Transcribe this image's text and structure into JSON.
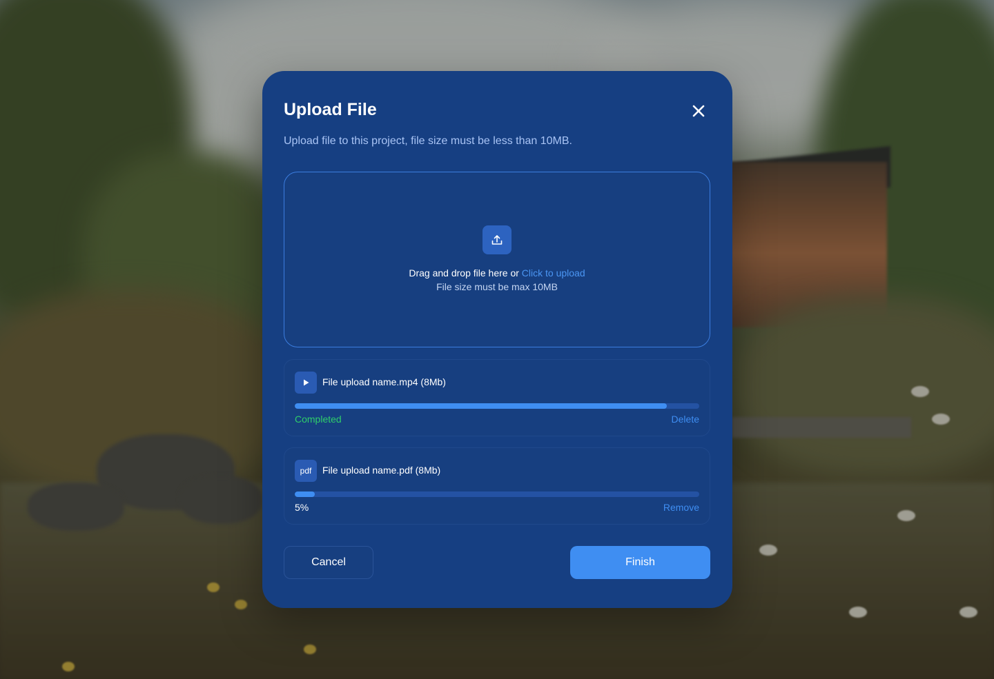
{
  "modal": {
    "title": "Upload File",
    "subtitle": "Upload file to this project, file size must be less than 10MB.",
    "close_icon": "close-icon"
  },
  "dropzone": {
    "icon": "upload-icon",
    "prompt": "Drag and drop file here or ",
    "link": "Click to upload",
    "hint": "File size must be max 10MB"
  },
  "files": [
    {
      "icon": "play-icon",
      "icon_text": "",
      "name": "File upload name.mp4 (8Mb)",
      "progress": 0.92,
      "status": "Completed",
      "status_color": "#2fcf6a",
      "action": "Delete"
    },
    {
      "icon": "pdf-icon",
      "icon_text": "pdf",
      "name": "File upload name.pdf (8Mb)",
      "progress": 0.05,
      "status": "5%",
      "status_color": "#ffffff",
      "action": "Remove"
    }
  ],
  "footer": {
    "cancel_label": "Cancel",
    "finish_label": "Finish"
  },
  "colors": {
    "modal_bg": "#163f82",
    "accent": "#3f8ef2",
    "success": "#2fcf6a",
    "subtitle": "#a9c4f5"
  }
}
